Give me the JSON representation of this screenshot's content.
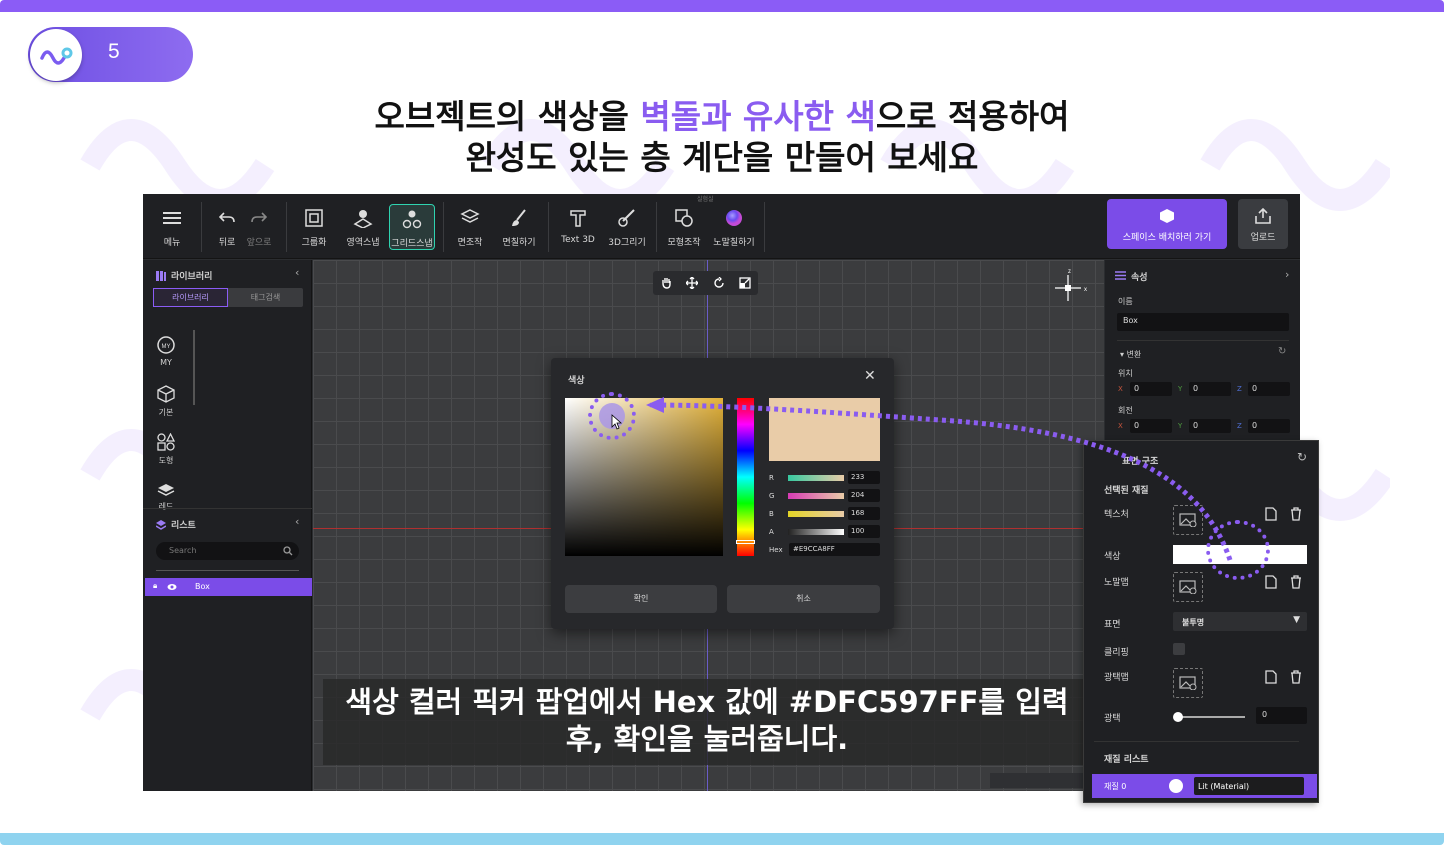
{
  "step": {
    "number": "5"
  },
  "title": {
    "line1_a": "오브젝트의 색상을 ",
    "line1_hl": "벽돌과 유사한 색",
    "line1_b": "으로 적용하여",
    "line2": "완성도 있는 층 계단을 만들어 보세요"
  },
  "toolbar": {
    "menu": "메뉴",
    "undo": "뒤로",
    "redo": "앞으로",
    "group": "그룹화",
    "area_snap": "영역스냅",
    "grid_snap": "그리드스냅",
    "face_edit": "면조작",
    "face_paint": "면칠하기",
    "text3d": "Text 3D",
    "draw3d": "3D그리기",
    "model_edit": "모형조작",
    "normal_paint": "노말칠하기",
    "top_tiny": "실험실",
    "space_button": "스페이스 배치하러 가기",
    "upload": "업로드"
  },
  "left_panel": {
    "library_title": "라이브러리",
    "tab_library": "라이브러리",
    "tab_tag_search": "태그검색",
    "cat_my": "MY",
    "cat_basic": "기본",
    "cat_shape": "도형",
    "cat_cut": "레드",
    "list_title": "리스트",
    "search_placeholder": "Search",
    "list_item": "Box"
  },
  "right_panel": {
    "title": "속성",
    "name_label": "이름",
    "name_value": "Box",
    "transform": "변환",
    "position": "위치",
    "rotation": "회전",
    "x": "X",
    "y": "Y",
    "z": "Z",
    "pos_x": "0",
    "pos_y": "0",
    "pos_z": "0",
    "rot_x": "0",
    "rot_y": "0",
    "rot_z": "0"
  },
  "color_dialog": {
    "title": "색상",
    "r_label": "R",
    "r_value": "233",
    "g_label": "G",
    "g_value": "204",
    "b_label": "B",
    "b_value": "168",
    "a_label": "A",
    "a_value": "100",
    "hex_label": "Hex",
    "hex_value": "#E9CCA8FF",
    "confirm": "확인",
    "cancel": "취소",
    "preview_color": "#E9CCA8"
  },
  "subtitle": {
    "line1": "색상 컬러 픽커 팝업에서 Hex 값에 #DFC597FF를 입력",
    "line2": "후, 확인을 눌러줍니다."
  },
  "material_panel": {
    "title": "표면 구조",
    "selected_material": "선택된 재질",
    "texture": "텍스처",
    "color": "색상",
    "normal_map": "노말맵",
    "surface": "표면",
    "surface_value": "불투명",
    "clipping": "클리핑",
    "gloss_map": "광택맵",
    "gloss": "광택",
    "gloss_value": "0",
    "material_list": "재질 리스트",
    "material_item": "재질 0",
    "material_type": "Lit (Material)"
  },
  "colors": {
    "accent": "#8a5cf0",
    "active_teal": "#2fd3b0",
    "app_bg": "#1f2023"
  }
}
